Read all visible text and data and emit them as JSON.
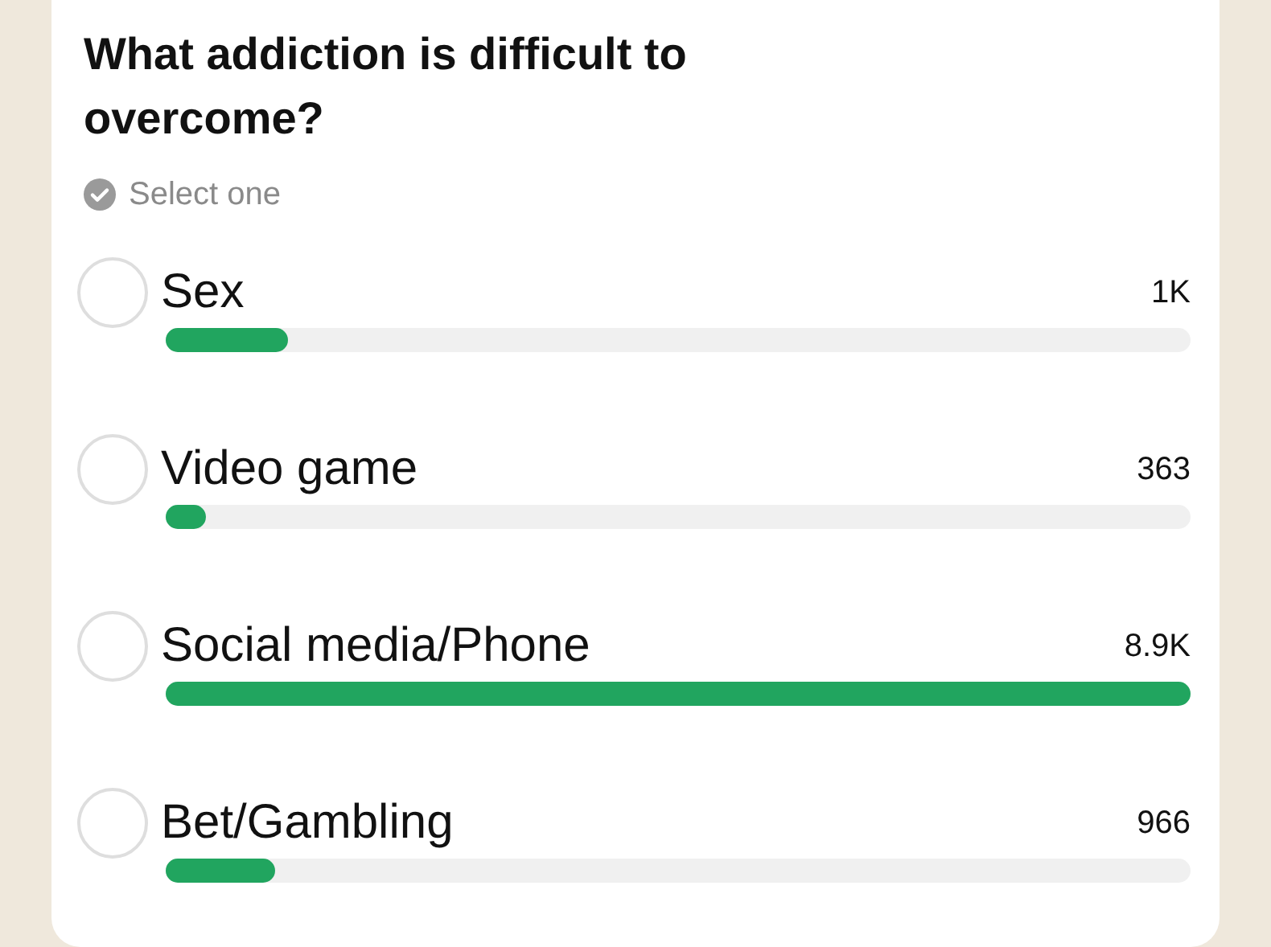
{
  "poll": {
    "question": "What addiction is difficult to overcome?",
    "hint": "Select one",
    "options": [
      {
        "label": "Sex",
        "count": "1K",
        "selected": false,
        "level": 0.12
      },
      {
        "label": "Video game",
        "count": "363",
        "selected": false,
        "level": 0.04
      },
      {
        "label": "Social media/Phone",
        "count": "8.9K",
        "selected": false,
        "level": 1.0
      },
      {
        "label": "Bet/Gambling",
        "count": "966",
        "selected": false,
        "level": 0.107
      }
    ]
  }
}
